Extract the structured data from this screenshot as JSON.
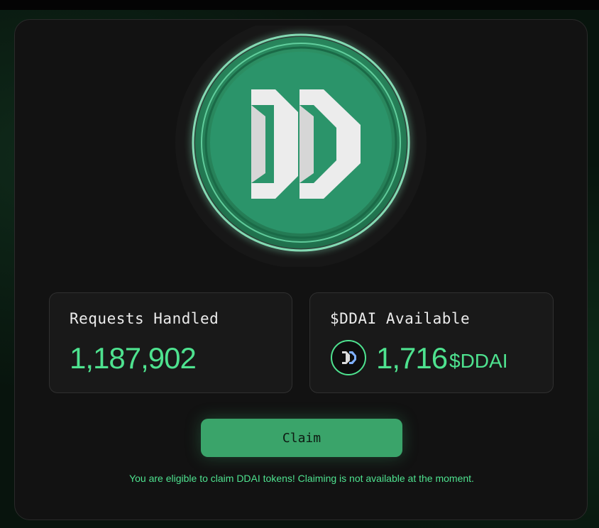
{
  "logo": {
    "icon": "ddai-logo-coin"
  },
  "stats": {
    "requests": {
      "title": "Requests Handled",
      "value": "1,187,902"
    },
    "ddai": {
      "title": "$DDAI Available",
      "value": "1,716",
      "unit": "$DDAI",
      "icon": "ddai-token-icon"
    }
  },
  "claim": {
    "label": "Claim",
    "note": "You are eligible to claim DDAI tokens! Claiming is not available at the moment."
  },
  "colors": {
    "accent": "#4ee28f",
    "button": "#3aa46a",
    "coin": "#2f9e6a",
    "card": "#121212"
  }
}
